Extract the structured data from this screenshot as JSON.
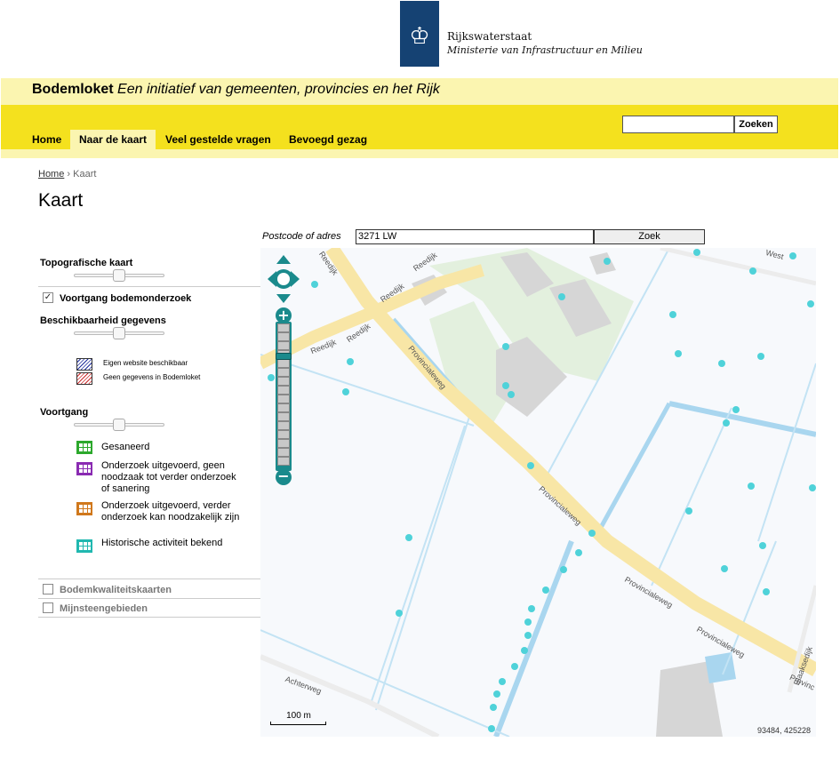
{
  "header": {
    "org_name": "Rijkswaterstaat",
    "ministry": "Ministerie van Infrastructuur en Milieu",
    "logo_icon": "crest-icon",
    "site_name": "Bodemloket",
    "tagline": "Een initiatief van gemeenten, provincies en het Rijk"
  },
  "nav": {
    "items": [
      {
        "label": "Home"
      },
      {
        "label": "Naar de kaart"
      },
      {
        "label": "Veel gestelde vragen"
      },
      {
        "label": "Bevoegd gezag"
      }
    ],
    "active_index": 1,
    "search_value": "",
    "search_button": "Zoeken"
  },
  "breadcrumb": {
    "home": "Home",
    "separator": "›",
    "current": "Kaart"
  },
  "page": {
    "title": "Kaart"
  },
  "postcode": {
    "label": "Postcode of adres",
    "value": "3271 LW",
    "button": "Zoek"
  },
  "sidebar": {
    "topo_title": "Topografische kaart",
    "voortgang_checkbox": {
      "label": "Voortgang bodemonderzoek",
      "checked": true
    },
    "beschikbaarheid_title": "Beschikbaarheid gegevens",
    "beschikbaarheid_legend": [
      {
        "label": "Eigen website beschikbaar",
        "color": "#1a2a9c"
      },
      {
        "label": "Geen gegevens in Bodemloket",
        "color": "#cc2a2a"
      }
    ],
    "voortgang_title": "Voortgang",
    "voortgang_legend": [
      {
        "label": "Gesaneerd",
        "color": "#2ca82c"
      },
      {
        "label": "Onderzoek uitgevoerd, geen noodzaak tot verder onderzoek of sanering",
        "color": "#8a2bb2"
      },
      {
        "label": "Onderzoek uitgevoerd, verder onderzoek kan noodzakelijk zijn",
        "color": "#d0781c"
      },
      {
        "label": "Historische activiteit bekend",
        "color": "#20b8b0"
      }
    ],
    "bodemkwaliteit": {
      "label": "Bodemkwaliteitskaarten",
      "checked": false
    },
    "mijnsteen": {
      "label": "Mijnsteengebieden",
      "checked": false
    }
  },
  "map": {
    "scale_label": "100 m",
    "coordinates": "93484, 425228",
    "road_labels": [
      "Reedijk",
      "Reedijk",
      "Reedijk",
      "Reedijk",
      "Provincialeweg",
      "Provincialeweg",
      "Provincialeweg",
      "Provincialeweg",
      "Achterweg",
      "Blaaksedijk",
      "Reedijk",
      "Provinc",
      "West"
    ],
    "colors": {
      "road": "#f8e6a6",
      "water": "#a9d6ef",
      "building": "#d6d6d6",
      "green": "#dcefd8",
      "dot": "#4fd2d9"
    }
  }
}
